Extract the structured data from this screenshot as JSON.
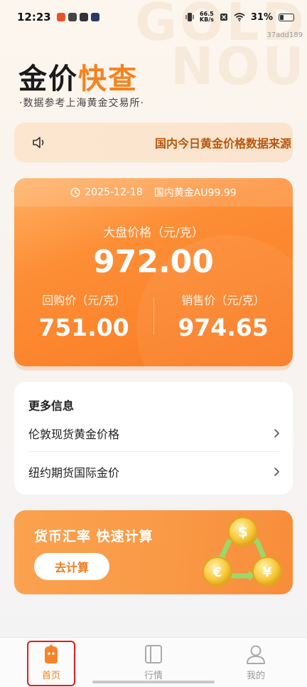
{
  "status_bar": {
    "time": "12:23",
    "net_speed_value": "66.5",
    "net_speed_unit": "KB/s",
    "battery": "31%"
  },
  "version": "37add189",
  "watermark": "GOLD NOU",
  "header": {
    "title_part1": "金价",
    "title_part2": "快查",
    "subtitle": "·数据参考上海黄金交易所·"
  },
  "notice": {
    "text": "国内今日黄金价格数据来源"
  },
  "price_card": {
    "date": "2025-12-18",
    "product": "国内黄金AU99.99",
    "main_label": "大盘价格（元/克）",
    "main_value": "972.00",
    "buyback_label": "回购价（元/克）",
    "buyback_value": "751.00",
    "sell_label": "销售价（元/克）",
    "sell_value": "974.65"
  },
  "more_info": {
    "title": "更多信息",
    "items": [
      {
        "label": "伦敦现货黄金价格"
      },
      {
        "label": "纽约期货国际金价"
      }
    ]
  },
  "fx_card": {
    "title": "货币汇率 快速计算",
    "button": "去计算"
  },
  "nav": {
    "items": [
      {
        "label": "首页",
        "icon": "home-icon",
        "active": true
      },
      {
        "label": "行情",
        "icon": "market-icon",
        "active": false
      },
      {
        "label": "我的",
        "icon": "profile-icon",
        "active": false
      }
    ]
  },
  "colors": {
    "accent": "#f5831f",
    "card_orange": "#fd8e36",
    "notice_text": "#b8560c",
    "highlight": "#e41c1c"
  }
}
